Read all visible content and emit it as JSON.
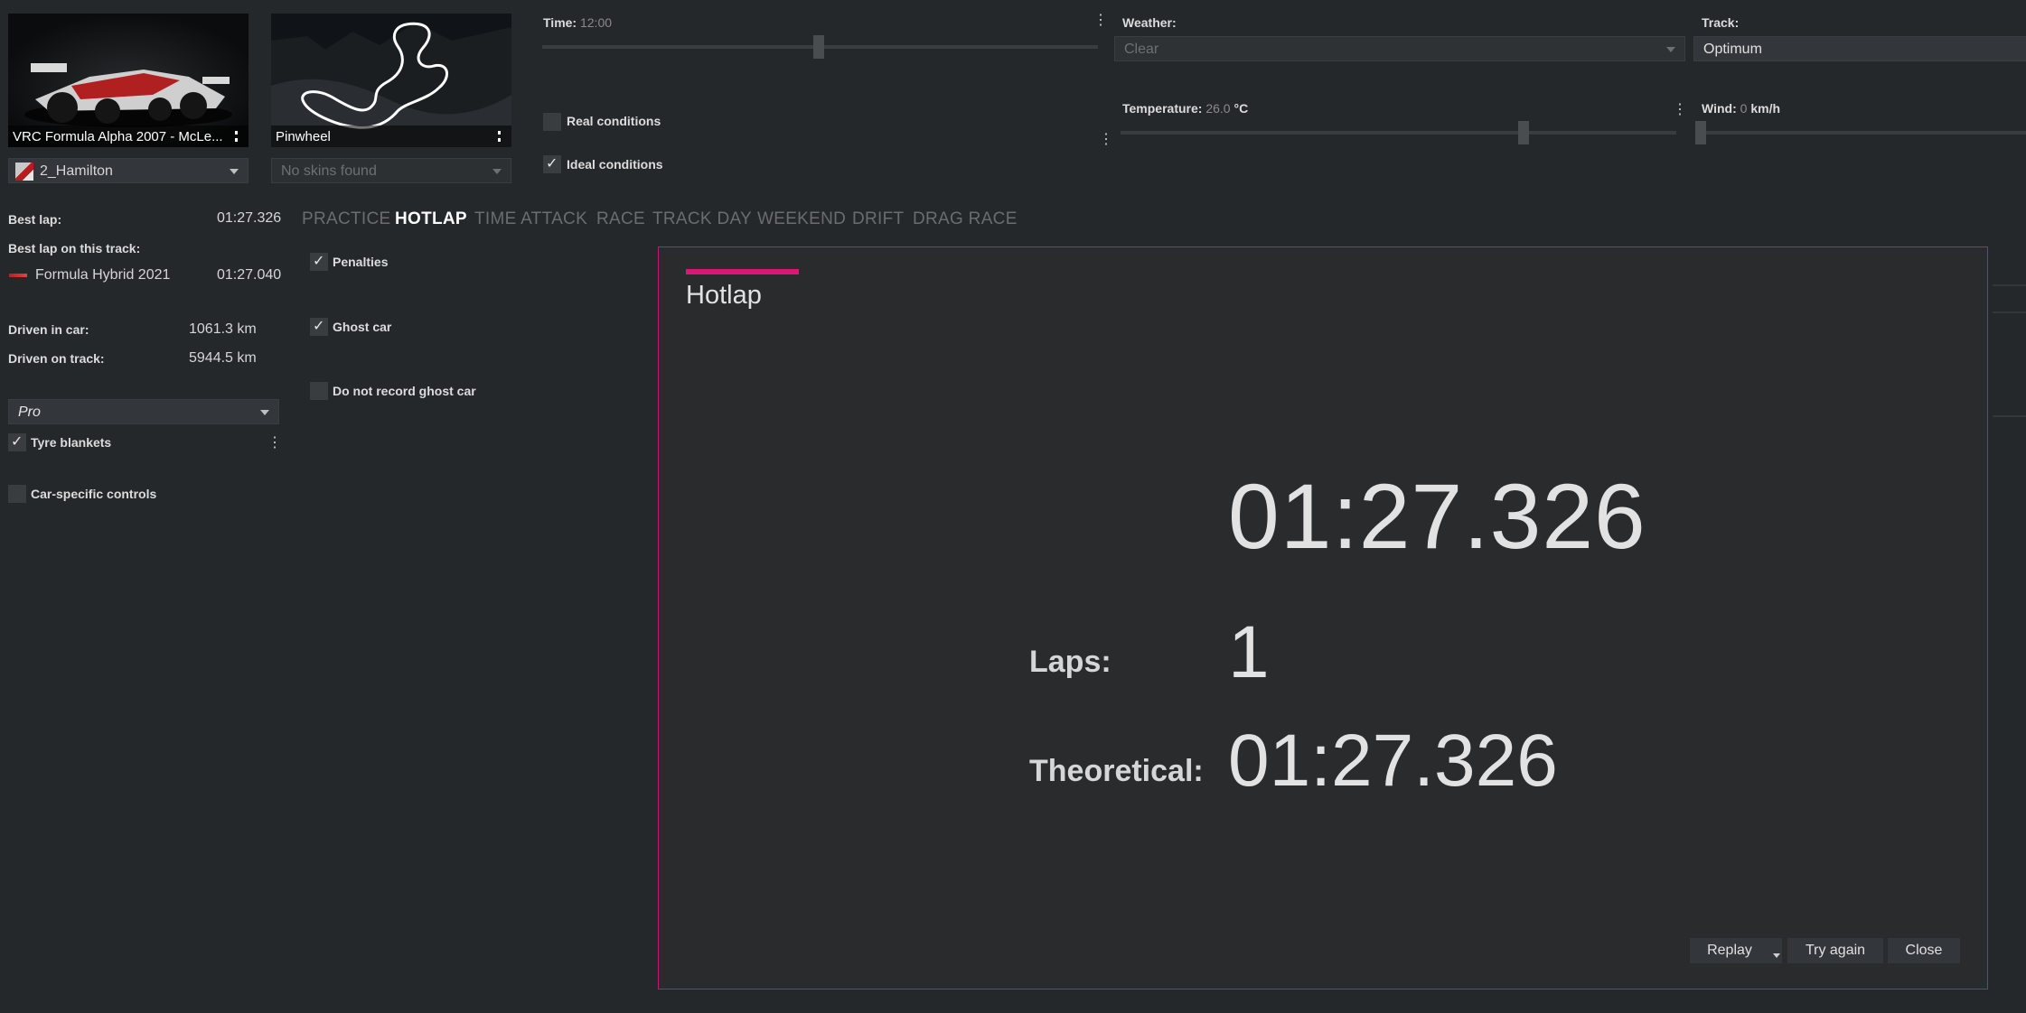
{
  "car": {
    "name": "VRC Formula Alpha 2007 - McLe...",
    "skin": "2_Hamilton"
  },
  "track": {
    "name": "Pinwheel",
    "skin_placeholder": "No skins found"
  },
  "conditions": {
    "time_label": "Time:",
    "time_value": "12:00",
    "real_conditions": "Real conditions",
    "ideal_conditions": "Ideal conditions",
    "weather_label": "Weather:",
    "weather_value": "Clear",
    "track_label": "Track:",
    "track_value": "Optimum",
    "temperature_label": "Temperature:",
    "temperature_value": "26.0",
    "temperature_unit": "°C",
    "wind_label": "Wind:",
    "wind_value": "0",
    "wind_unit": "km/h"
  },
  "stats": {
    "best_lap_label": "Best lap:",
    "best_lap_value": "01:27.326",
    "best_on_track_label": "Best lap on this track:",
    "best_on_track_car": "Formula Hybrid 2021",
    "best_on_track_value": "01:27.040",
    "driven_car_label": "Driven in car:",
    "driven_car_value": "1061.3 km",
    "driven_track_label": "Driven on track:",
    "driven_track_value": "5944.5 km"
  },
  "assists": {
    "preset": "Pro",
    "tyre_blankets": "Tyre blankets",
    "car_specific": "Car-specific controls"
  },
  "tabs": [
    "PRACTICE",
    "HOTLAP",
    "TIME ATTACK",
    "RACE",
    "TRACK DAY",
    "WEEKEND",
    "DRIFT",
    "DRAG RACE"
  ],
  "hotlap_options": {
    "penalties": "Penalties",
    "ghost_car": "Ghost car",
    "no_record_ghost": "Do not record ghost car"
  },
  "dialog": {
    "title": "Hotlap",
    "best_time": "01:27.326",
    "laps_label": "Laps:",
    "laps_value": "1",
    "theoretical_label": "Theoretical:",
    "theoretical_value": "01:27.326",
    "replay": "Replay",
    "try_again": "Try again",
    "close": "Close",
    "accent_color": "#e0157a"
  }
}
